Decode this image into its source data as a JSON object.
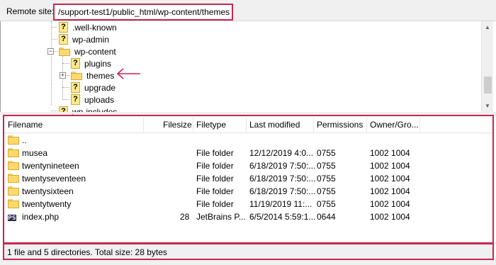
{
  "remote_site": {
    "label": "Remote site:",
    "path": "/support-test1/public_html/wp-content/themes"
  },
  "tree": {
    "items": [
      {
        "label": ".well-known",
        "icon": "question-folder-icon"
      },
      {
        "label": "wp-admin",
        "icon": "question-folder-icon"
      },
      {
        "label": "wp-content",
        "icon": "folder-icon",
        "expanded": true
      },
      {
        "label": "plugins",
        "icon": "question-folder-icon"
      },
      {
        "label": "themes",
        "icon": "folder-icon",
        "selected": true
      },
      {
        "label": "upgrade",
        "icon": "question-folder-icon"
      },
      {
        "label": "uploads",
        "icon": "question-folder-icon"
      },
      {
        "label": "wp-includes",
        "icon": "question-folder-icon"
      }
    ],
    "expand_glyph": "+",
    "collapse_glyph": "−"
  },
  "columns": {
    "filename": "Filename",
    "filesize": "Filesize",
    "filetype": "Filetype",
    "last_modified": "Last modified",
    "permissions": "Permissions",
    "owner_group": "Owner/Gro..."
  },
  "files": [
    {
      "name": "..",
      "size": "",
      "type": "",
      "modified": "",
      "perms": "",
      "owner": "",
      "icon": "folder-icon"
    },
    {
      "name": "musea",
      "size": "",
      "type": "File folder",
      "modified": "12/12/2019 4:0...",
      "perms": "0755",
      "owner": "1002 1004",
      "icon": "folder-icon"
    },
    {
      "name": "twentynineteen",
      "size": "",
      "type": "File folder",
      "modified": "6/18/2019 7:50:...",
      "perms": "0755",
      "owner": "1002 1004",
      "icon": "folder-icon"
    },
    {
      "name": "twentyseventeen",
      "size": "",
      "type": "File folder",
      "modified": "6/18/2019 7:50:...",
      "perms": "0755",
      "owner": "1002 1004",
      "icon": "folder-icon"
    },
    {
      "name": "twentysixteen",
      "size": "",
      "type": "File folder",
      "modified": "6/18/2019 7:50:...",
      "perms": "0755",
      "owner": "1002 1004",
      "icon": "folder-icon"
    },
    {
      "name": "twentytwenty",
      "size": "",
      "type": "File folder",
      "modified": "11/19/2019 11:...",
      "perms": "0755",
      "owner": "1002 1004",
      "icon": "folder-icon"
    },
    {
      "name": "index.php",
      "size": "28",
      "type": "JetBrains P...",
      "modified": "6/5/2014 5:59:1...",
      "perms": "0644",
      "owner": "1002 1004",
      "icon": "phpstorm-icon",
      "icon_text": "PS"
    }
  ],
  "status": {
    "text": "1 file and 5 directories. Total size: 28 bytes"
  },
  "colors": {
    "highlight": "#c8274e",
    "folder": "#ffd96b"
  }
}
